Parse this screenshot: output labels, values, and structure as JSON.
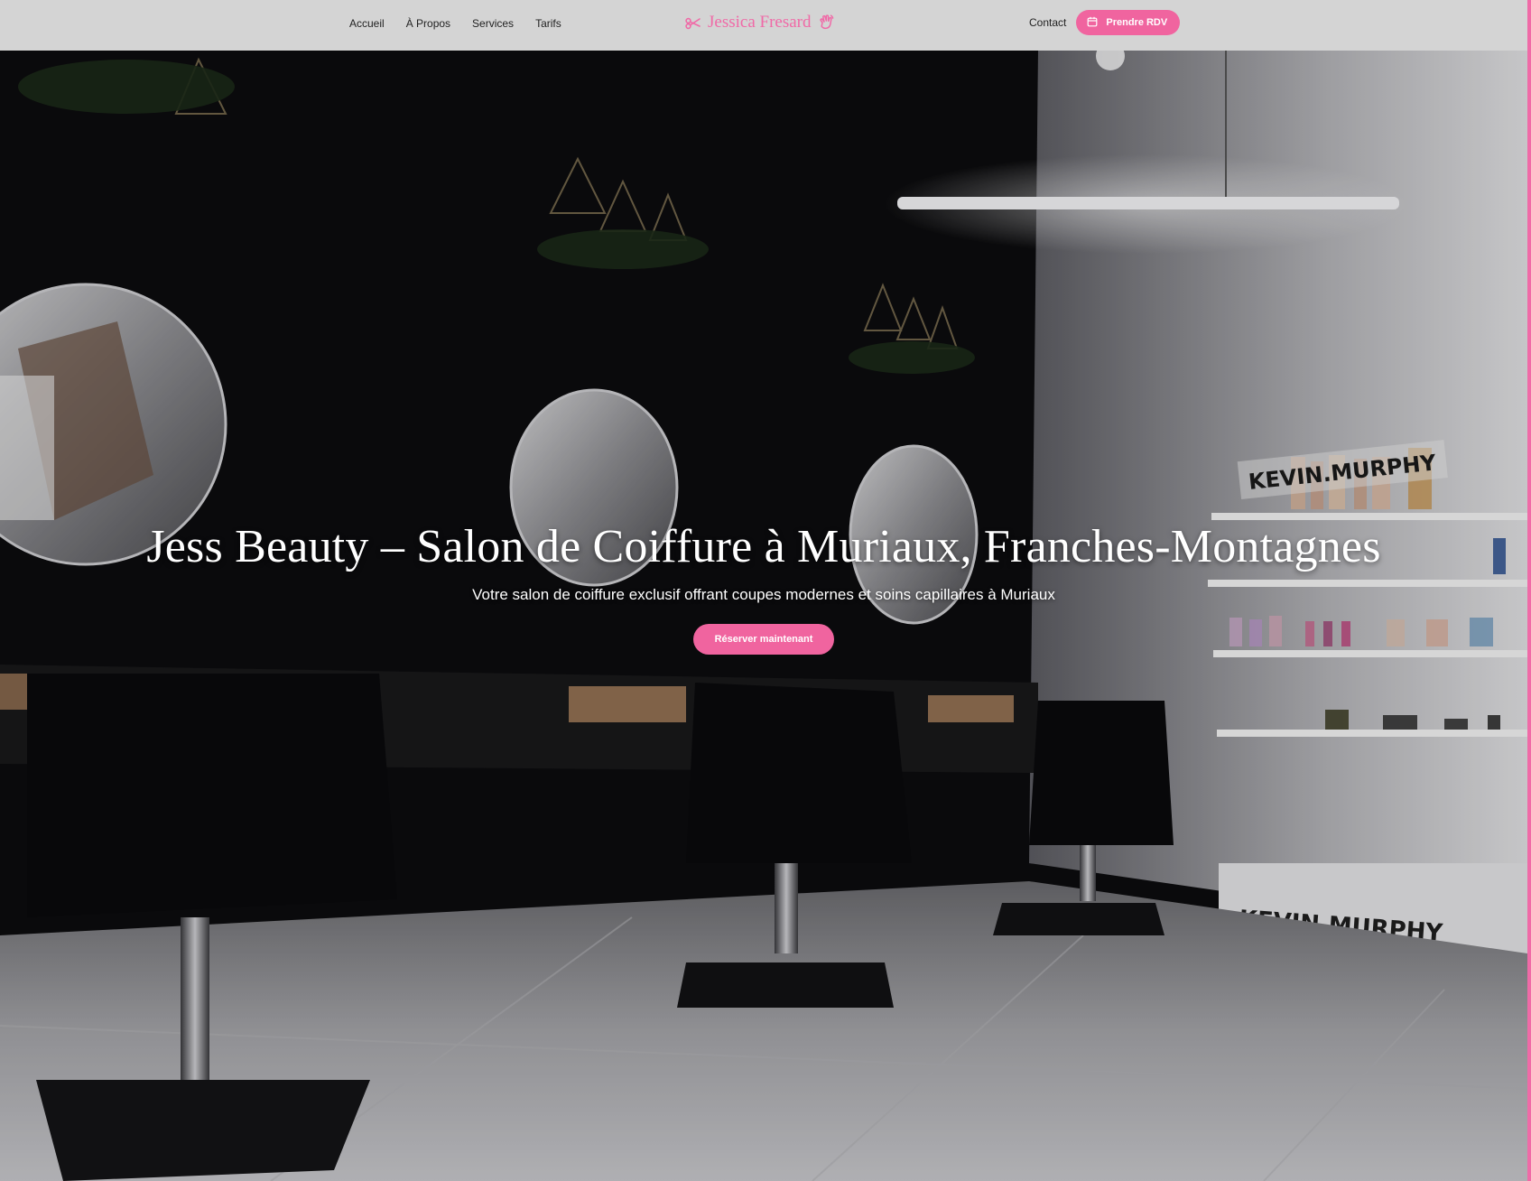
{
  "header": {
    "nav_left": [
      {
        "label": "Accueil"
      },
      {
        "label": "À Propos"
      },
      {
        "label": "Services"
      },
      {
        "label": "Tarifs"
      }
    ],
    "logo": {
      "text": "Jessica Fresard",
      "left_icon": "scissors-icon",
      "right_icon": "hand-wave-icon"
    },
    "contact_label": "Contact",
    "cta": {
      "label": "Prendre RDV",
      "icon": "calendar-icon"
    }
  },
  "hero": {
    "title": "Jess Beauty – Salon de Coiffure à Muriaux, Franches-Montagnes",
    "subtitle": "Votre salon de coiffure exclusif offrant coupes modernes et soins capillaires à Muriaux",
    "cta_label": "Réserver maintenant",
    "brand_sign_1": "KEVIN.MURPHY",
    "brand_sign_2": "KEVIN.MURPHY"
  },
  "colors": {
    "accent": "#f0649f",
    "header_bg": "#d4d4d4",
    "logo": "#f06aa7",
    "wall_dark": "#0c0c0e"
  }
}
